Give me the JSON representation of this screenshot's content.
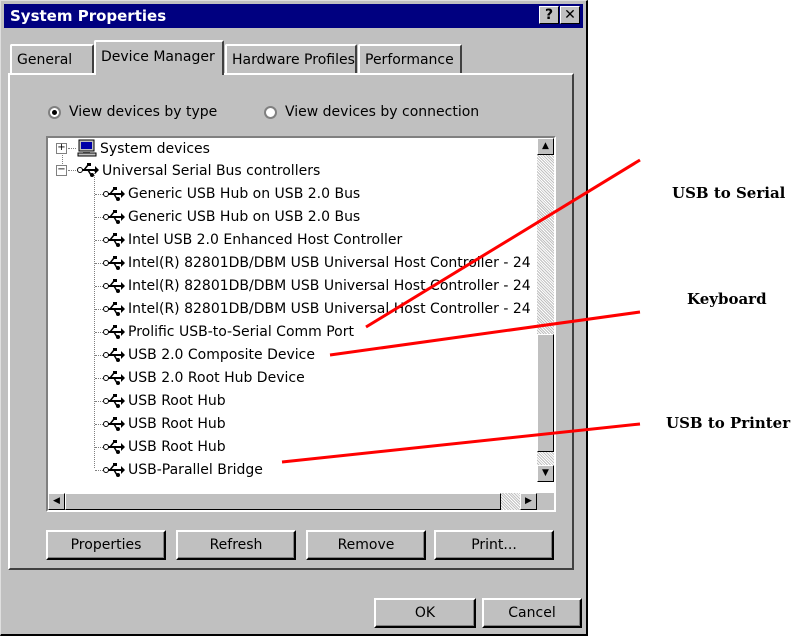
{
  "window": {
    "title": "System Properties",
    "help_button": "?",
    "close_button": "✕"
  },
  "tabs": [
    {
      "label": "General",
      "active": false
    },
    {
      "label": "Device Manager",
      "active": true
    },
    {
      "label": "Hardware Profiles",
      "active": false
    },
    {
      "label": "Performance",
      "active": false
    }
  ],
  "view_options": {
    "by_type": {
      "label": "View devices by type",
      "selected": true
    },
    "by_connection": {
      "label": "View devices by connection",
      "selected": false
    }
  },
  "device_tree": {
    "items": [
      {
        "label": "System devices",
        "expander": "+",
        "icon": "computer-icon"
      },
      {
        "label": "Universal Serial Bus controllers",
        "expander": "−",
        "icon": "usb-icon"
      },
      {
        "label": "Generic USB Hub on USB 2.0 Bus",
        "icon": "usb-icon"
      },
      {
        "label": "Generic USB Hub on USB 2.0 Bus",
        "icon": "usb-icon"
      },
      {
        "label": "Intel USB 2.0 Enhanced Host Controller",
        "icon": "usb-icon"
      },
      {
        "label": "Intel(R) 82801DB/DBM USB Universal Host Controller - 24",
        "icon": "usb-icon"
      },
      {
        "label": "Intel(R) 82801DB/DBM USB Universal Host Controller - 24",
        "icon": "usb-icon"
      },
      {
        "label": "Intel(R) 82801DB/DBM USB Universal Host Controller - 24",
        "icon": "usb-icon"
      },
      {
        "label": "Prolific USB-to-Serial Comm Port",
        "icon": "usb-icon"
      },
      {
        "label": "USB 2.0 Composite Device",
        "icon": "usb-icon"
      },
      {
        "label": "USB 2.0 Root Hub Device",
        "icon": "usb-icon"
      },
      {
        "label": "USB Root Hub",
        "icon": "usb-icon"
      },
      {
        "label": "USB Root Hub",
        "icon": "usb-icon"
      },
      {
        "label": "USB Root Hub",
        "icon": "usb-icon"
      },
      {
        "label": "USB-Parallel Bridge",
        "icon": "usb-icon"
      }
    ]
  },
  "scroll_arrows": {
    "up": "▲",
    "down": "▼",
    "left": "◀",
    "right": "▶"
  },
  "actions": {
    "properties": "Properties",
    "refresh": "Refresh",
    "remove": "Remove",
    "print": "Print..."
  },
  "dialog": {
    "ok": "OK",
    "cancel": "Cancel"
  },
  "annotations": {
    "usb_to_serial": "USB to Serial",
    "keyboard": "Keyboard",
    "usb_to_printer": "USB to Printer"
  },
  "colors": {
    "title_bar": "#000080",
    "face": "#c0c0c0",
    "annotation_line": "#ff0000"
  }
}
